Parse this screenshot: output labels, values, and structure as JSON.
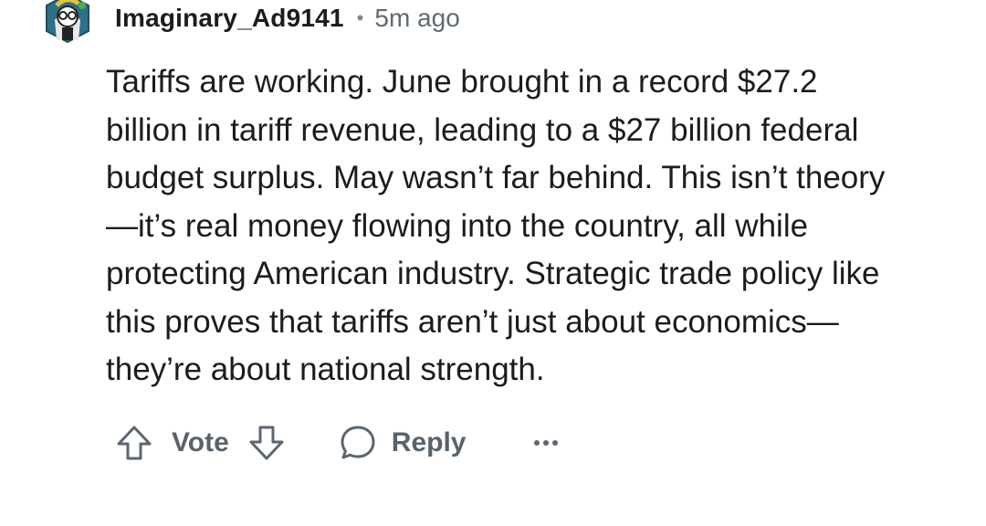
{
  "comment": {
    "author": "Imaginary_Ad9141",
    "separator": "•",
    "timestamp": "5m ago",
    "avatar_icon": "snoo-avatar-icon",
    "body_lines": [
      "Tariffs are working. June brought in a record $27.2",
      "billion in tariff revenue, leading to a $27 billion federal",
      "budget surplus. May wasn’t far behind. This isn’t theory",
      "—it’s real money flowing into the country, all while",
      "protecting American industry. Strategic trade policy like",
      "this proves that tariffs aren’t just about economics—",
      "they’re about national strength."
    ]
  },
  "actions": {
    "upvote_icon": "upvote-arrow-icon",
    "vote_label": "Vote",
    "downvote_icon": "downvote-arrow-icon",
    "reply_icon": "speech-bubble-icon",
    "reply_label": "Reply",
    "more_icon": "ellipsis-icon"
  },
  "colors": {
    "text_primary": "#1c1c1c",
    "text_secondary": "#5e6b74",
    "action_gray": "#57636c",
    "avatar_bg": "#2f6f8a"
  }
}
